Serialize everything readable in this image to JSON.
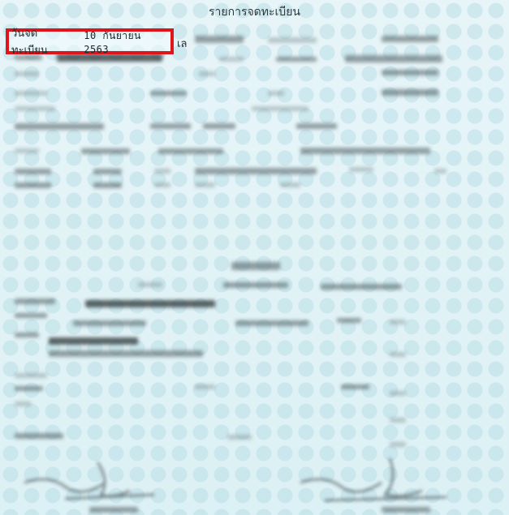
{
  "document": {
    "title": "รายการจดทะเบียน",
    "registration_date_label": "วันจดทะเบียน",
    "registration_date_value": "10 กันยายน 2563",
    "number_label_partial": "เล"
  },
  "highlight_color": "#e0141b",
  "redacted_note": ""
}
